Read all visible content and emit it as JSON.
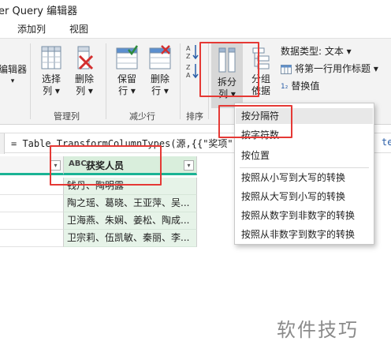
{
  "window": {
    "title": "er Query 编辑器"
  },
  "menu": {
    "tabs": [
      "添加列",
      "视图"
    ]
  },
  "ribbon": {
    "btn_left_partial": "编辑器",
    "select_cols": {
      "line1": "选择",
      "line2": "列"
    },
    "remove_cols": {
      "line1": "删除",
      "line2": "列"
    },
    "keep_rows": {
      "line1": "保留",
      "line2": "行"
    },
    "remove_rows": {
      "line1": "删除",
      "line2": "行"
    },
    "split_col": {
      "line1": "拆分",
      "line2": "列"
    },
    "group_by": {
      "line1": "分组",
      "line2": "依据"
    },
    "groups": {
      "manage_cols": "管理列",
      "reduce_rows": "减少行",
      "sort": "排序"
    },
    "data_type": "数据类型: 文本",
    "first_row_header": "将第一行用作标题",
    "replace_values": "替换值",
    "replace_prefix": "1₂"
  },
  "formula": {
    "text": "= Table.TransformColumnTypes(源,{{\"奖项\"",
    "right": "te"
  },
  "table": {
    "column_type": "ABC",
    "column_name": "获奖人员",
    "rows": [
      "钱丹、陶明露",
      "陶之瑶、葛晓、王亚萍、吴...",
      "卫海燕、朱娴、姜松、陶成...",
      "卫宗莉、伍凯敏、秦丽、李..."
    ]
  },
  "split_menu": {
    "items": [
      "按分隔符",
      "按字符数",
      "按位置",
      "按照从小写到大写的转换",
      "按照从大写到小写的转换",
      "按照从数字到非数字的转换",
      "按照从非数字到数字的转换"
    ]
  },
  "watermark": "软件技巧",
  "colors": {
    "highlight": "#e53935",
    "accent": "#1ab394",
    "column_bg": "#e6f3e8"
  }
}
